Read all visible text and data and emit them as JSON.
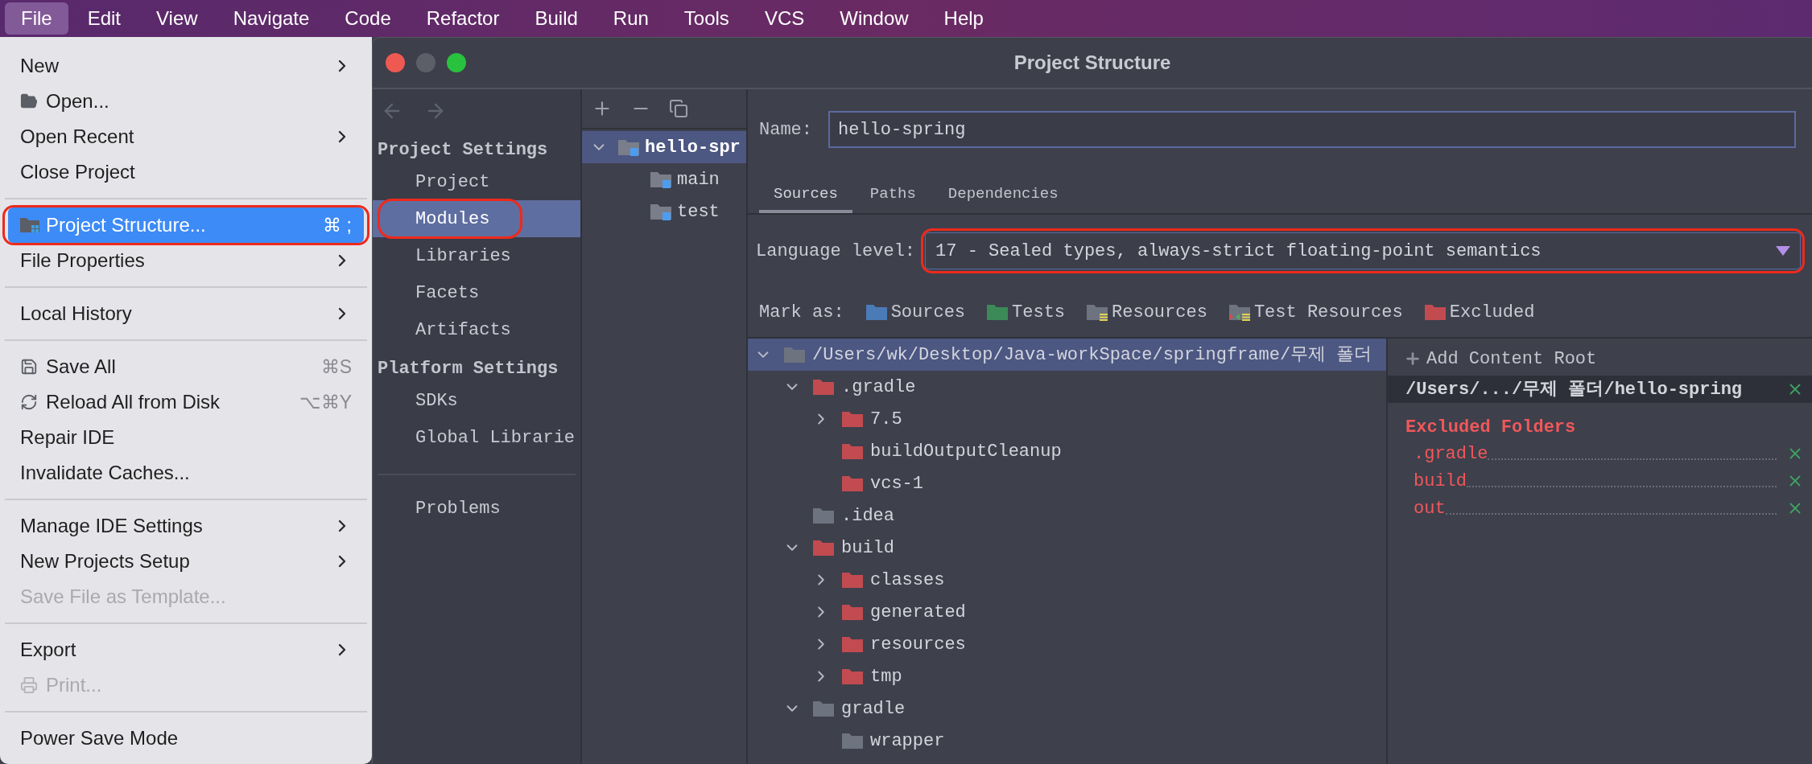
{
  "menu_bar": [
    {
      "label": "File",
      "selected": true
    },
    {
      "label": "Edit",
      "selected": false
    },
    {
      "label": "View",
      "selected": false
    },
    {
      "label": "Navigate",
      "selected": false
    },
    {
      "label": "Code",
      "selected": false
    },
    {
      "label": "Refactor",
      "selected": false
    },
    {
      "label": "Build",
      "selected": false
    },
    {
      "label": "Run",
      "selected": false
    },
    {
      "label": "Tools",
      "selected": false
    },
    {
      "label": "VCS",
      "selected": false
    },
    {
      "label": "Window",
      "selected": false
    },
    {
      "label": "Help",
      "selected": false
    }
  ],
  "file_menu": [
    [
      {
        "label": "New",
        "kind": "plain",
        "submenu": true,
        "disabled": false,
        "selected": false,
        "circled": false
      },
      {
        "label": "Open...",
        "kind": "open",
        "submenu": false,
        "disabled": false,
        "selected": false,
        "circled": false
      },
      {
        "label": "Open Recent",
        "kind": "plain",
        "submenu": true,
        "disabled": false,
        "selected": false,
        "circled": false
      },
      {
        "label": "Close Project",
        "kind": "plain",
        "submenu": false,
        "disabled": false,
        "selected": false,
        "circled": false
      }
    ],
    [
      {
        "label": "Project Structure...",
        "kind": "structure",
        "shortcut": "⌘ ;",
        "submenu": false,
        "disabled": false,
        "selected": true,
        "circled": true
      },
      {
        "label": "File Properties",
        "kind": "plain",
        "submenu": true,
        "disabled": false,
        "selected": false,
        "circled": false
      }
    ],
    [
      {
        "label": "Local History",
        "kind": "plain",
        "submenu": true,
        "disabled": false,
        "selected": false,
        "circled": false
      }
    ],
    [
      {
        "label": "Save All",
        "kind": "save",
        "shortcut": "⌘S",
        "submenu": false,
        "disabled": false,
        "selected": false,
        "circled": false
      },
      {
        "label": "Reload All from Disk",
        "kind": "reload",
        "shortcut": "⌥⌘Y",
        "submenu": false,
        "disabled": false,
        "selected": false,
        "circled": false
      },
      {
        "label": "Repair IDE",
        "kind": "plain",
        "submenu": false,
        "disabled": false,
        "selected": false,
        "circled": false
      },
      {
        "label": "Invalidate Caches...",
        "kind": "plain",
        "submenu": false,
        "disabled": false,
        "selected": false,
        "circled": false
      }
    ],
    [
      {
        "label": "Manage IDE Settings",
        "kind": "plain",
        "submenu": true,
        "disabled": false,
        "selected": false,
        "circled": false
      },
      {
        "label": "New Projects Setup",
        "kind": "plain",
        "submenu": true,
        "disabled": false,
        "selected": false,
        "circled": false
      },
      {
        "label": "Save File as Template...",
        "kind": "plain",
        "submenu": false,
        "disabled": true,
        "selected": false,
        "circled": false
      }
    ],
    [
      {
        "label": "Export",
        "kind": "plain",
        "submenu": true,
        "disabled": false,
        "selected": false,
        "circled": false
      },
      {
        "label": "Print...",
        "kind": "print",
        "submenu": false,
        "disabled": true,
        "selected": false,
        "circled": false
      }
    ],
    [
      {
        "label": "Power Save Mode",
        "kind": "plain",
        "submenu": false,
        "disabled": false,
        "selected": false,
        "circled": false
      }
    ]
  ],
  "dialog": {
    "title": "Project Structure",
    "sidebar": [
      {
        "heading": "Project Settings",
        "items": [
          {
            "label": "Project",
            "selected": false,
            "circled": false
          },
          {
            "label": "Modules",
            "selected": true,
            "circled": true
          },
          {
            "label": "Libraries",
            "selected": false,
            "circled": false
          },
          {
            "label": "Facets",
            "selected": false,
            "circled": false
          },
          {
            "label": "Artifacts",
            "selected": false,
            "circled": false
          }
        ]
      },
      {
        "heading": "Platform Settings",
        "items": [
          {
            "label": "SDKs",
            "selected": false,
            "circled": false
          },
          {
            "label": "Global Librarie",
            "selected": false,
            "circled": false
          }
        ]
      }
    ],
    "sidebar_footer": [
      {
        "label": "Problems",
        "selected": false
      }
    ],
    "modules": [
      {
        "label": "hello-spr",
        "selected": true,
        "expanded": true,
        "children": [
          {
            "label": "main",
            "selected": false
          },
          {
            "label": "test",
            "selected": false
          }
        ]
      }
    ],
    "name_label": "Name:",
    "name_value": "hello-spring",
    "tabs": [
      {
        "label": "Sources",
        "selected": true
      },
      {
        "label": "Paths",
        "selected": false
      },
      {
        "label": "Dependencies",
        "selected": false
      }
    ],
    "language_level": {
      "label": "Language level:",
      "value": "17 - Sealed types, always-strict floating-point semantics",
      "circled": true
    },
    "mark_as": {
      "label": "Mark as:",
      "items": [
        {
          "label": "Sources",
          "color": "#4a7bb7",
          "kind": "plain"
        },
        {
          "label": "Tests",
          "color": "#3b8a57",
          "kind": "plain"
        },
        {
          "label": "Resources",
          "color": "#6e7380",
          "kind": "resources"
        },
        {
          "label": "Test Resources",
          "color": "#6e7380",
          "kind": "test-resources"
        },
        {
          "label": "Excluded",
          "color": "#c24b50",
          "kind": "plain"
        }
      ]
    },
    "tree": [
      {
        "label": "/Users/wk/Desktop/Java-workSpace/springframe/무제 폴더",
        "color": "#6e7380",
        "expandable": true,
        "expanded": true,
        "selected": true,
        "children": [
          {
            "label": ".gradle",
            "color": "#c24b50",
            "expandable": true,
            "expanded": true,
            "selected": false,
            "children": [
              {
                "label": "7.5",
                "color": "#c24b50",
                "expandable": true,
                "expanded": false,
                "selected": false
              },
              {
                "label": "buildOutputCleanup",
                "color": "#c24b50",
                "expandable": false,
                "expanded": false,
                "selected": false
              },
              {
                "label": "vcs-1",
                "color": "#c24b50",
                "expandable": false,
                "expanded": false,
                "selected": false
              }
            ]
          },
          {
            "label": ".idea",
            "color": "#6e7380",
            "expandable": false,
            "expanded": false,
            "selected": false
          },
          {
            "label": "build",
            "color": "#c24b50",
            "expandable": true,
            "expanded": true,
            "selected": false,
            "children": [
              {
                "label": "classes",
                "color": "#c24b50",
                "expandable": true,
                "expanded": false,
                "selected": false
              },
              {
                "label": "generated",
                "color": "#c24b50",
                "expandable": true,
                "expanded": false,
                "selected": false
              },
              {
                "label": "resources",
                "color": "#c24b50",
                "expandable": true,
                "expanded": false,
                "selected": false
              },
              {
                "label": "tmp",
                "color": "#c24b50",
                "expandable": true,
                "expanded": false,
                "selected": false
              }
            ]
          },
          {
            "label": "gradle",
            "color": "#6e7380",
            "expandable": true,
            "expanded": true,
            "selected": false,
            "children": [
              {
                "label": "wrapper",
                "color": "#6e7380",
                "expandable": false,
                "expanded": false,
                "selected": false
              }
            ]
          }
        ]
      }
    ],
    "content_root": {
      "add_label": "Add Content Root",
      "path": "/Users/.../무제 폴더/hello-spring",
      "excluded_heading": "Excluded Folders",
      "excluded": [
        ".gradle",
        "build",
        "out"
      ]
    }
  }
}
